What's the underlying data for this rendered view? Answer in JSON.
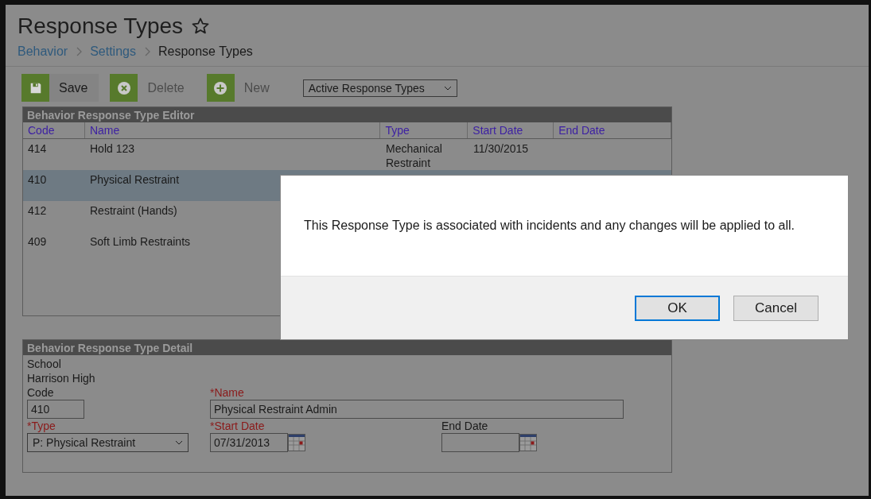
{
  "page": {
    "title": "Response Types",
    "favorite": false
  },
  "breadcrumb": [
    {
      "label": "Behavior",
      "link": true
    },
    {
      "label": "Settings",
      "link": true
    },
    {
      "label": "Response Types",
      "link": false
    }
  ],
  "toolbar": {
    "buttons": [
      {
        "kind": "save",
        "label": "Save",
        "disabled": false
      },
      {
        "kind": "delete",
        "label": "Delete",
        "disabled": true
      },
      {
        "kind": "new",
        "label": "New",
        "disabled": true
      }
    ],
    "filter": {
      "value": "Active Response Types"
    }
  },
  "editor": {
    "title": "Behavior Response Type Editor",
    "columns": [
      "Code",
      "Name",
      "Type",
      "Start Date",
      "End Date"
    ],
    "rows": [
      {
        "cells": [
          "414",
          "Hold 123",
          "Mechanical Restraint",
          "11/30/2015"
        ],
        "selected": false
      },
      {
        "cells": [
          "410",
          "Physical Restraint"
        ],
        "selected": true
      },
      {
        "cells": [
          "412",
          "Restraint (Hands)"
        ],
        "selected": false
      },
      {
        "cells": [
          "409",
          "Soft Limb Restraints"
        ],
        "selected": false
      }
    ]
  },
  "detail": {
    "title": "Behavior Response Type Detail",
    "school_label": "School",
    "school": "Harrison High",
    "code": {
      "label": "Code",
      "value": "410",
      "required": false
    },
    "name": {
      "label": "*Name",
      "value": "Physical Restraint Admin",
      "required": true
    },
    "type": {
      "label": "*Type",
      "value": "P: Physical Restraint",
      "required": true
    },
    "start_date": {
      "label": "*Start Date",
      "value": "07/31/2013",
      "required": true
    },
    "end_date": {
      "label": "End Date",
      "required": false
    }
  },
  "dialog": {
    "message": "This Response Type is associated with incidents and any changes will be applied to all.",
    "buttons": [
      {
        "label": "OK",
        "focused": true
      },
      {
        "label": "Cancel",
        "focused": false
      }
    ]
  }
}
